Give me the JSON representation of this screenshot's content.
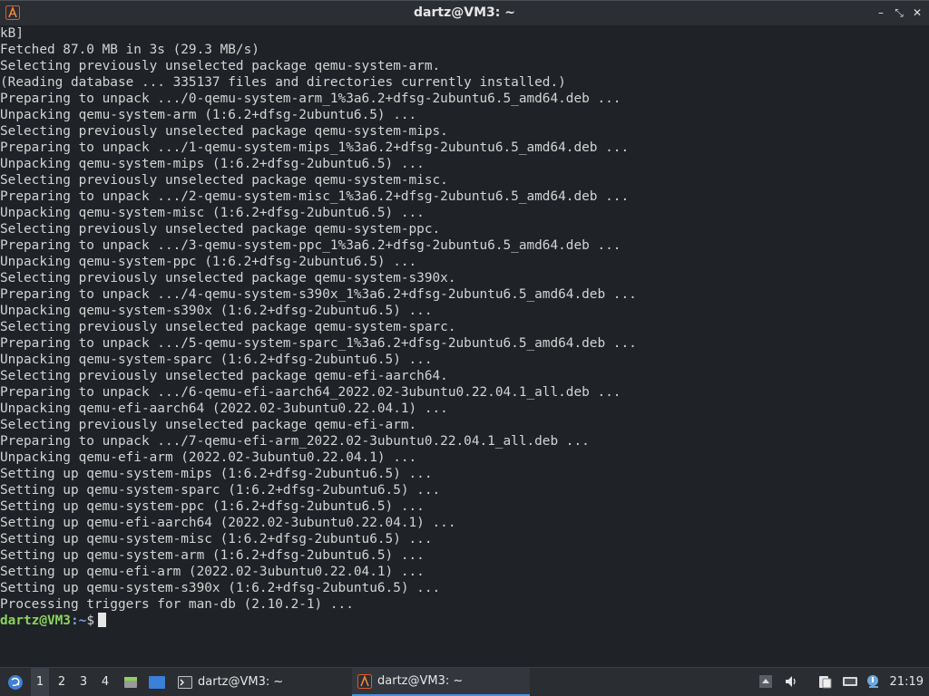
{
  "window": {
    "title": "dartz@VM3: ~",
    "minimize_label": "–",
    "maximize_label": "⤡",
    "close_label": "✕"
  },
  "terminal": {
    "lines": [
      "kB]",
      "Fetched 87.0 MB in 3s (29.3 MB/s)",
      "Selecting previously unselected package qemu-system-arm.",
      "(Reading database ... 335137 files and directories currently installed.)",
      "Preparing to unpack .../0-qemu-system-arm_1%3a6.2+dfsg-2ubuntu6.5_amd64.deb ...",
      "Unpacking qemu-system-arm (1:6.2+dfsg-2ubuntu6.5) ...",
      "Selecting previously unselected package qemu-system-mips.",
      "Preparing to unpack .../1-qemu-system-mips_1%3a6.2+dfsg-2ubuntu6.5_amd64.deb ...",
      "Unpacking qemu-system-mips (1:6.2+dfsg-2ubuntu6.5) ...",
      "Selecting previously unselected package qemu-system-misc.",
      "Preparing to unpack .../2-qemu-system-misc_1%3a6.2+dfsg-2ubuntu6.5_amd64.deb ...",
      "Unpacking qemu-system-misc (1:6.2+dfsg-2ubuntu6.5) ...",
      "Selecting previously unselected package qemu-system-ppc.",
      "Preparing to unpack .../3-qemu-system-ppc_1%3a6.2+dfsg-2ubuntu6.5_amd64.deb ...",
      "Unpacking qemu-system-ppc (1:6.2+dfsg-2ubuntu6.5) ...",
      "Selecting previously unselected package qemu-system-s390x.",
      "Preparing to unpack .../4-qemu-system-s390x_1%3a6.2+dfsg-2ubuntu6.5_amd64.deb ...",
      "Unpacking qemu-system-s390x (1:6.2+dfsg-2ubuntu6.5) ...",
      "Selecting previously unselected package qemu-system-sparc.",
      "Preparing to unpack .../5-qemu-system-sparc_1%3a6.2+dfsg-2ubuntu6.5_amd64.deb ...",
      "Unpacking qemu-system-sparc (1:6.2+dfsg-2ubuntu6.5) ...",
      "Selecting previously unselected package qemu-efi-aarch64.",
      "Preparing to unpack .../6-qemu-efi-aarch64_2022.02-3ubuntu0.22.04.1_all.deb ...",
      "Unpacking qemu-efi-aarch64 (2022.02-3ubuntu0.22.04.1) ...",
      "Selecting previously unselected package qemu-efi-arm.",
      "Preparing to unpack .../7-qemu-efi-arm_2022.02-3ubuntu0.22.04.1_all.deb ...",
      "Unpacking qemu-efi-arm (2022.02-3ubuntu0.22.04.1) ...",
      "Setting up qemu-system-mips (1:6.2+dfsg-2ubuntu6.5) ...",
      "Setting up qemu-system-sparc (1:6.2+dfsg-2ubuntu6.5) ...",
      "Setting up qemu-system-ppc (1:6.2+dfsg-2ubuntu6.5) ...",
      "Setting up qemu-efi-aarch64 (2022.02-3ubuntu0.22.04.1) ...",
      "Setting up qemu-system-misc (1:6.2+dfsg-2ubuntu6.5) ...",
      "Setting up qemu-system-arm (1:6.2+dfsg-2ubuntu6.5) ...",
      "Setting up qemu-efi-arm (2022.02-3ubuntu0.22.04.1) ...",
      "Setting up qemu-system-s390x (1:6.2+dfsg-2ubuntu6.5) ...",
      "Processing triggers for man-db (2.10.2-1) ..."
    ],
    "prompt": {
      "user_host": "dartz@VM3",
      "path": ":~",
      "symbol": "$"
    }
  },
  "taskbar": {
    "workspaces": [
      "1",
      "2",
      "3",
      "4"
    ],
    "active_workspace": "1",
    "tasks": [
      {
        "label": "dartz@VM3: ~",
        "icon": "terminal-icon",
        "active": false
      },
      {
        "label": "dartz@VM3: ~",
        "icon": "terminal-app-icon",
        "active": true
      }
    ],
    "clock": "21:19"
  },
  "colors": {
    "terminal_bg": "#1f2226",
    "terminal_fg": "#d4d4d4",
    "prompt_user": "#8ad45c",
    "prompt_path": "#7aa6f0",
    "accent": "#4a90d9"
  }
}
